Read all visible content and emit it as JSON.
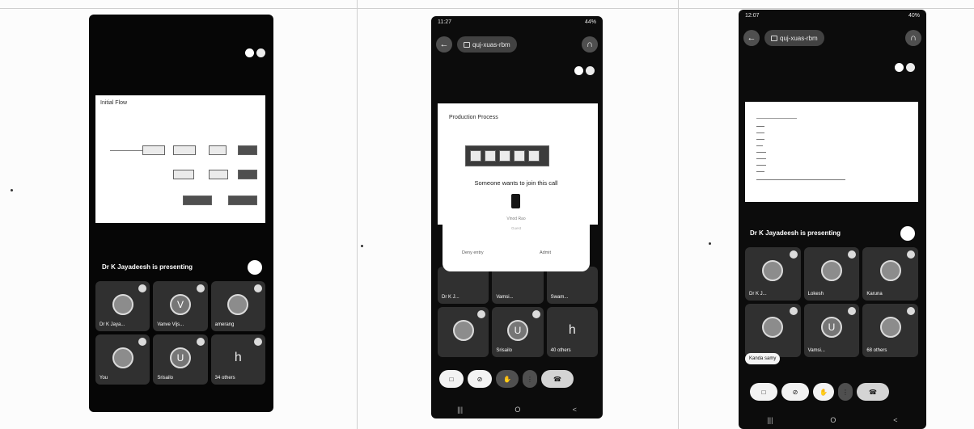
{
  "phone1": {
    "slide_title": "Initial Flow",
    "presenting": "Dr K Jayadeesh is presenting",
    "tiles": [
      {
        "name": "Dr K Jaya...",
        "icon": "person-icon"
      },
      {
        "name": "Vanve Vijs...",
        "icon": "person-icon"
      },
      {
        "name": "amerang",
        "icon": "person-icon"
      },
      {
        "name": "You",
        "icon": "person-icon"
      },
      {
        "name": "Srisailo",
        "icon": "person-icon"
      },
      {
        "name": "34 others",
        "icon": "letter-h",
        "letter": "h"
      }
    ]
  },
  "phone2": {
    "status_time": "11:27",
    "status_battery": "44%",
    "meeting_code": "quj-xuas-rbm",
    "slide_title": "Production Process",
    "dialog_title": "Someone wants to join this call",
    "dialog_name": "Vinod Rao",
    "dialog_sub": "Guest",
    "dialog_deny": "Deny entry",
    "dialog_admit": "Admit",
    "tiles": [
      {
        "name": "Dr K J...",
        "icon": "person-icon"
      },
      {
        "name": "Vamsi...",
        "icon": "person-icon"
      },
      {
        "name": "Swam...",
        "icon": "person-icon"
      },
      {
        "name": "",
        "icon": "person-icon"
      },
      {
        "name": "Srisailo",
        "icon": "person-icon"
      },
      {
        "name": "40 others",
        "icon": "letter-h",
        "letter": "h"
      }
    ]
  },
  "phone3": {
    "status_time": "12:07",
    "status_battery": "40%",
    "meeting_code": "quj-xuas-rbm",
    "presenting": "Dr K Jayadeesh is presenting",
    "toast": "Kanda samy",
    "tiles": [
      {
        "name": "Dr K J...",
        "icon": "person-icon"
      },
      {
        "name": "Lokesh",
        "icon": "person-icon"
      },
      {
        "name": "Karuna",
        "icon": "person-icon"
      },
      {
        "name": "",
        "icon": "person-icon"
      },
      {
        "name": "Vamsi...",
        "icon": "person-icon"
      },
      {
        "name": "68 others",
        "icon": "person-icon"
      }
    ]
  },
  "navbar": {
    "recents": "|||",
    "home": "O",
    "back": "<"
  },
  "colors": {
    "background": "#fcfcfc",
    "screen": "#1b1b1b",
    "tile": "#3a3a3a"
  }
}
